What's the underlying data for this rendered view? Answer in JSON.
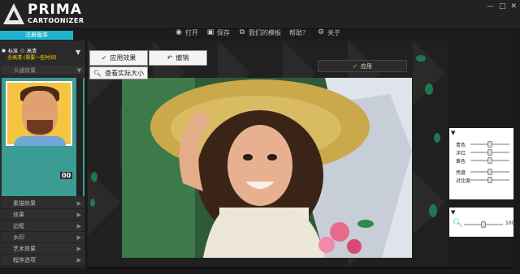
{
  "app": {
    "logo_line1": "PRIMA",
    "logo_line2": "CARTOONIZER"
  },
  "toolbar": {
    "items": [
      {
        "icon": "camera-icon",
        "label": "打开"
      },
      {
        "icon": "save-icon",
        "label": "保存"
      },
      {
        "icon": "export-icon",
        "label": "我们的模板"
      },
      {
        "icon": "help-icon",
        "label": "帮助？"
      },
      {
        "icon": "gear-icon",
        "label": "关于"
      }
    ]
  },
  "window": {
    "minimize": "—",
    "maximize": "□",
    "close": "✕"
  },
  "sidebar": {
    "register": "注册版本",
    "radio1": "标准",
    "radio2": "高清",
    "quality_note": "全高清 (需要一些时间)",
    "section_title": "卡通效果",
    "thumb_label": "00",
    "list": [
      "素描效果",
      "效果",
      "边框",
      "水印",
      "艺术效果",
      "程序选项"
    ]
  },
  "buttons": {
    "apply_effect": "应用效果",
    "undo": "撤销",
    "actual_size": "查看实际大小",
    "apply": "应用"
  },
  "adjust": {
    "labels": [
      "青色",
      "洋红",
      "黄色",
      "亮度",
      "对比度"
    ],
    "values": [
      0.5,
      0.5,
      0.5,
      0.5,
      0.5
    ]
  },
  "zoom": {
    "value_label": "100",
    "level": 0.5
  },
  "colors": {
    "accent": "#1fb4d0",
    "apply_check": "#3cb043",
    "quality_note": "#ffd400"
  }
}
